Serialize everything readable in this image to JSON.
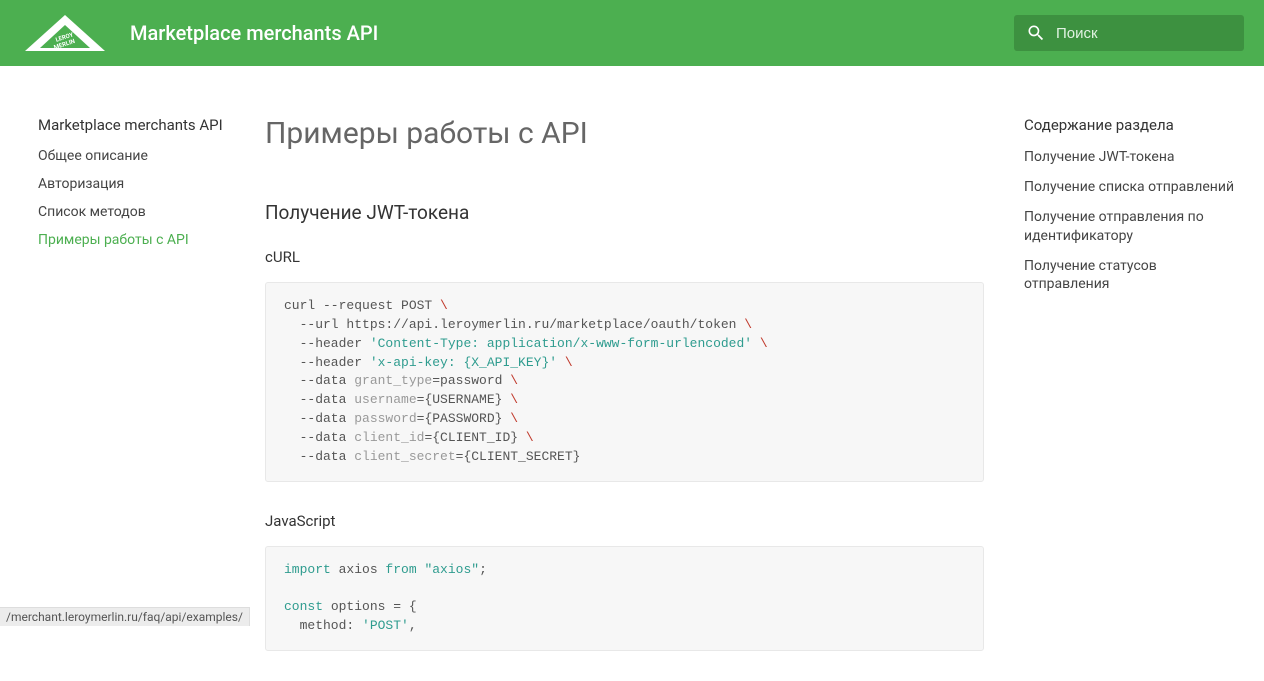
{
  "header": {
    "title": "Marketplace merchants API",
    "search_placeholder": "Поиск"
  },
  "sidebar": {
    "title": "Marketplace merchants API",
    "items": [
      {
        "label": "Общее описание",
        "active": false
      },
      {
        "label": "Авторизация",
        "active": false
      },
      {
        "label": "Список методов",
        "active": false
      },
      {
        "label": "Примеры работы с API",
        "active": true
      }
    ]
  },
  "content": {
    "page_title": "Примеры работы с API",
    "section1_title": "Получение JWT-токена",
    "curl_label": "cURL",
    "js_label": "JavaScript",
    "curl_code": {
      "l1a": "curl --request POST ",
      "slash": "\\",
      "l2a": "  --url https://api.leroymerlin.ru/marketplace/oauth/token ",
      "l3a": "  --header ",
      "l3s": "'Content-Type: application/x-www-form-urlencoded'",
      "sp": " ",
      "l4a": "  --header ",
      "l4s": "'x-api-key: {X_API_KEY}'",
      "l5a": "  --data ",
      "l5g": "grant_type",
      "l5b": "=password ",
      "l6a": "  --data ",
      "l6g": "username",
      "l6b": "={USERNAME} ",
      "l7a": "  --data ",
      "l7g": "password",
      "l7b": "={PASSWORD} ",
      "l8a": "  --data ",
      "l8g": "client_id",
      "l8b": "={CLIENT_ID} ",
      "l9a": "  --data ",
      "l9g": "client_secret",
      "l9b": "={CLIENT_SECRET}"
    },
    "js_code": {
      "l1_kw1": "import",
      "l1_mid": " axios ",
      "l1_kw2": "from",
      "l1_sp": " ",
      "l1_str": "\"axios\"",
      "l1_end": ";",
      "blank": "",
      "l2_kw": "const",
      "l2_rest": " options = {",
      "l3a": "  method: ",
      "l3s": "'POST'",
      "l3b": ","
    }
  },
  "toc": {
    "title": "Содержание раздела",
    "items": [
      {
        "label": "Получение JWT-токена"
      },
      {
        "label": "Получение списка отправлений"
      },
      {
        "label": "Получение отправления по идентификатору"
      },
      {
        "label": "Получение статусов отправления"
      }
    ]
  },
  "status_url": "/merchant.leroymerlin.ru/faq/api/examples/"
}
